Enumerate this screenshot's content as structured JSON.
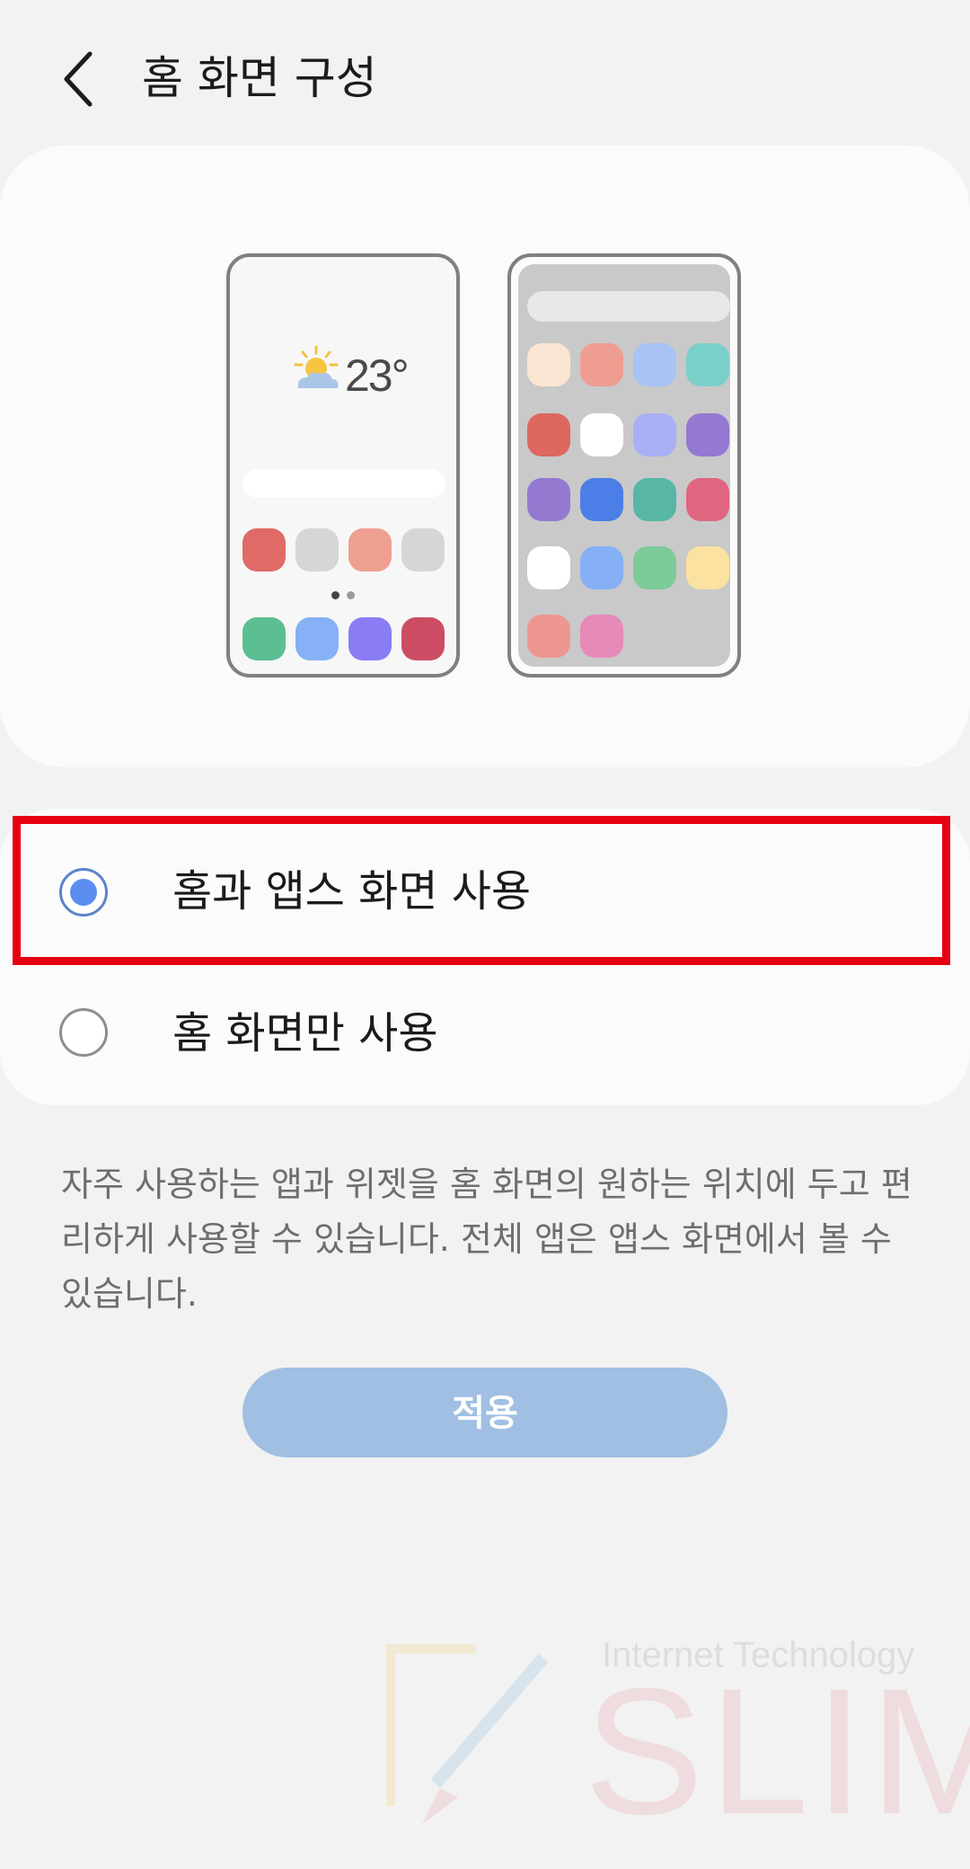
{
  "header": {
    "title": "홈 화면 구성"
  },
  "preview": {
    "weather_temperature": "23°",
    "home_icon_colors": [
      "#e06a66",
      "#d6d6d6",
      "#ef9f90",
      "#d6d6d6",
      "#5bbf93",
      "#87b1f6",
      "#8a7cf4",
      "#cc4d63"
    ],
    "apps_icon_colors": [
      "#fbe5d3",
      "#ef9d90",
      "#a8c3f4",
      "#79d0c8",
      "#de675f",
      "#ffffff",
      "#a9b0f6",
      "#9478d2",
      "#9479d1",
      "#4b7ee6",
      "#58b6a7",
      "#e0667f",
      "#ffffff",
      "#86b0f5",
      "#7ccb98",
      "#fbe2a0",
      "#ee9691",
      "#e68ab9"
    ]
  },
  "options": [
    {
      "label": "홈과 앱스 화면 사용",
      "selected": true
    },
    {
      "label": "홈 화면만 사용",
      "selected": false
    }
  ],
  "description": "자주 사용하는 앱과 위젯을 홈 화면의 원하는 위치에 두고 편리하게 사용할 수 있습니다. 전체 앱은 앱스 화면에서 볼 수 있습니다.",
  "apply_button": {
    "label": "적용"
  },
  "watermark": {
    "subtitle": "Internet Technology",
    "brand": "SLIM"
  },
  "colors": {
    "accent": "#5b8ef0",
    "highlight": "#e60012",
    "apply_button": "#a0bfe2"
  }
}
